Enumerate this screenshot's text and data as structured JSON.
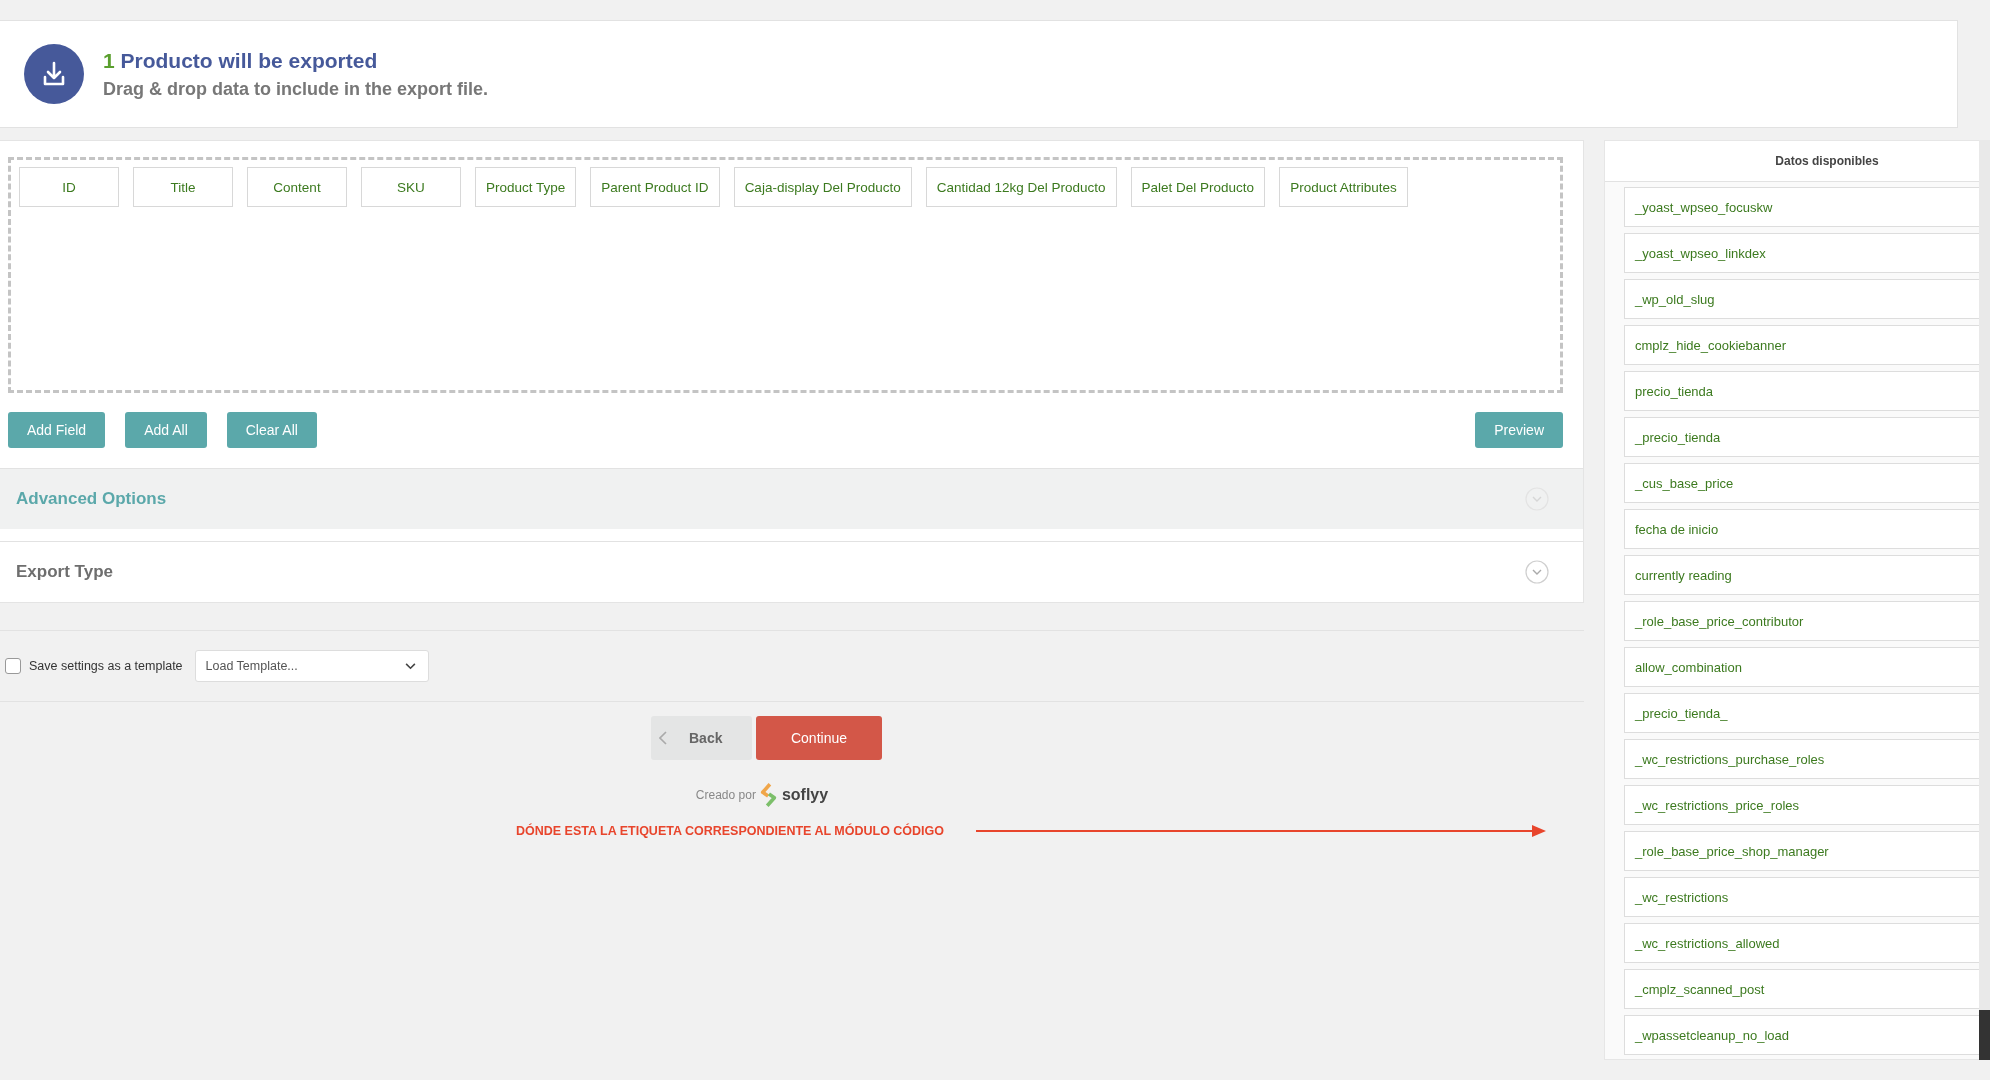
{
  "header": {
    "count": "1",
    "title": "Producto will be exported",
    "subtitle": "Drag & drop data to include in the export file."
  },
  "selected_fields": [
    "ID",
    "Title",
    "Content",
    "SKU",
    "Product Type",
    "Parent Product ID",
    "Caja-display Del Producto",
    "Cantidad 12kg Del Producto",
    "Palet Del Producto",
    "Product Attributes"
  ],
  "actions": [
    "Add Field",
    "Add All",
    "Clear All"
  ],
  "preview": "Preview",
  "sections": [
    {
      "title": "Advanced Options",
      "kind": "accent",
      "expanded": false
    },
    {
      "title": "Export Type",
      "kind": "plain",
      "expanded": false
    }
  ],
  "template": {
    "save_label": "Save settings as a template",
    "checked": false,
    "load_value": "Load Template..."
  },
  "nav": {
    "back": "Back",
    "continue": "Continue"
  },
  "credit": {
    "text": "Creado por",
    "brand": "soflyy"
  },
  "annotation": "DÓNDE ESTA LA ETIQUETA CORRESPONDIENTE AL MÓDULO CÓDIGO",
  "sidebar": {
    "title": "Datos disponibles",
    "items": [
      "_yoast_wpseo_focuskw",
      "_yoast_wpseo_linkdex",
      "_wp_old_slug",
      "cmplz_hide_cookiebanner",
      "precio_tienda",
      "_precio_tienda",
      "_cus_base_price",
      "fecha de inicio",
      "currently reading",
      "_role_base_price_contributor",
      "allow_combination",
      "_precio_tienda_",
      "_wc_restrictions_purchase_roles",
      "_wc_restrictions_price_roles",
      "_role_base_price_shop_manager",
      "_wc_restrictions",
      "_wc_restrictions_allowed",
      "_cmplz_scanned_post",
      "_wpassetcleanup_no_load"
    ]
  }
}
